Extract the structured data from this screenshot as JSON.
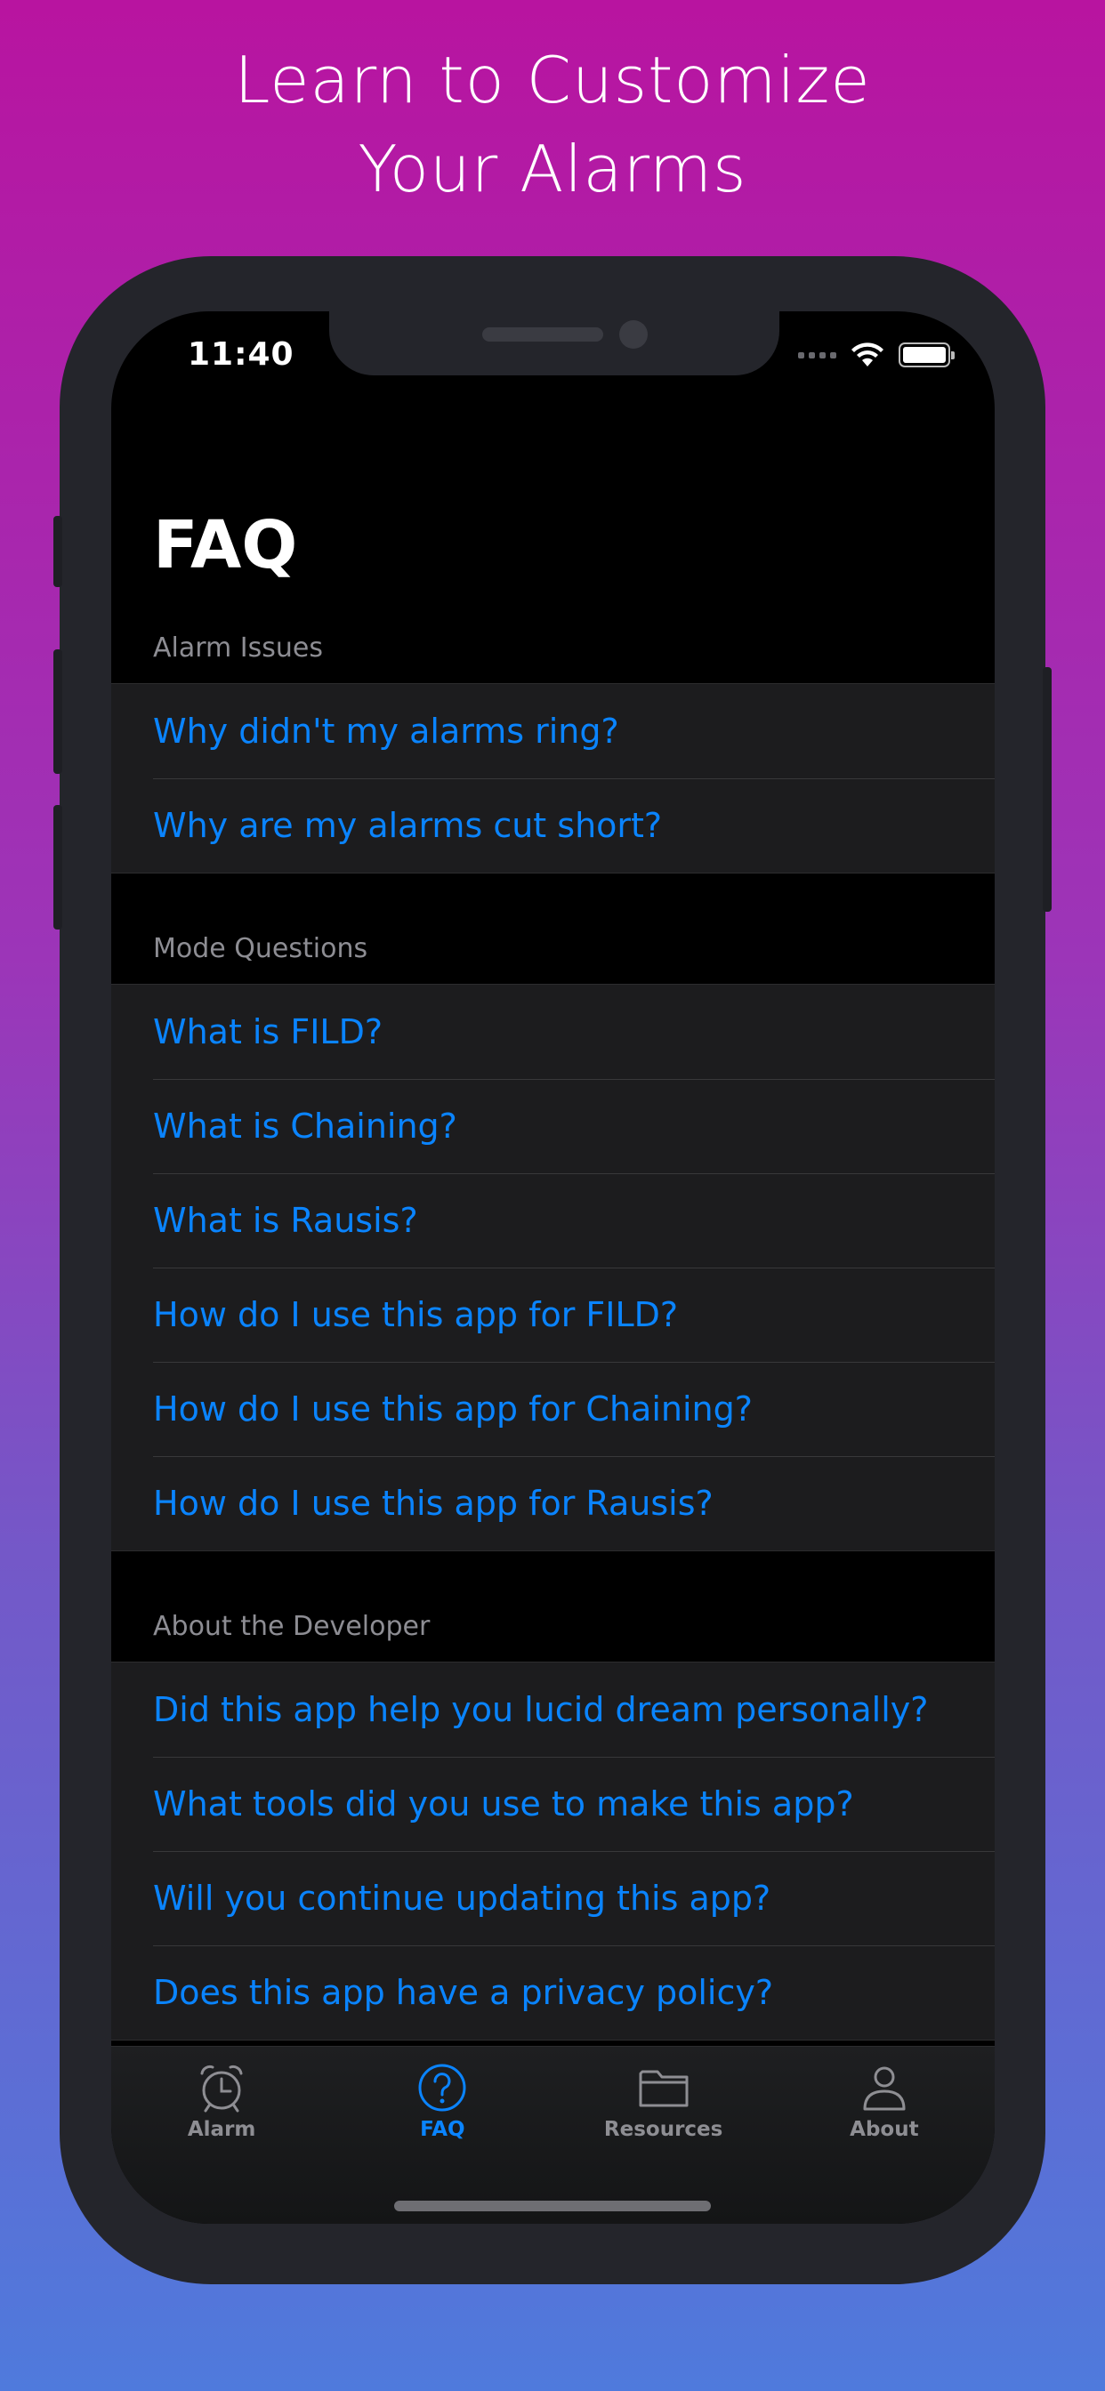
{
  "headline": {
    "line1": "Learn to Customize",
    "line2": "Your Alarms"
  },
  "status_bar": {
    "time": "11:40",
    "wifi_icon": "wifi-icon",
    "battery_icon": "battery-icon"
  },
  "page": {
    "title": "FAQ"
  },
  "sections": [
    {
      "header": "Alarm Issues",
      "items": [
        "Why didn't my alarms ring?",
        "Why are my alarms cut short?"
      ]
    },
    {
      "header": "Mode Questions",
      "items": [
        "What is FILD?",
        "What is Chaining?",
        "What is Rausis?",
        "How do I use this app for FILD?",
        "How do I use this app for Chaining?",
        "How do I use this app for Rausis?"
      ]
    },
    {
      "header": "About the Developer",
      "items": [
        "Did this app help you lucid dream personally?",
        "What tools did you use to make this app?",
        "Will you continue updating this app?",
        "Does this app have a privacy policy?"
      ]
    }
  ],
  "tab_bar": {
    "tabs": [
      {
        "label": "Alarm",
        "icon": "alarm-clock-icon"
      },
      {
        "label": "FAQ",
        "icon": "question-circle-icon"
      },
      {
        "label": "Resources",
        "icon": "folder-icon"
      },
      {
        "label": "About",
        "icon": "person-icon"
      }
    ],
    "selected": "FAQ"
  },
  "colors": {
    "accent": "#0a84ff",
    "inactive": "#8e8e93",
    "background": "#000000",
    "cell": "#1c1c1e"
  }
}
